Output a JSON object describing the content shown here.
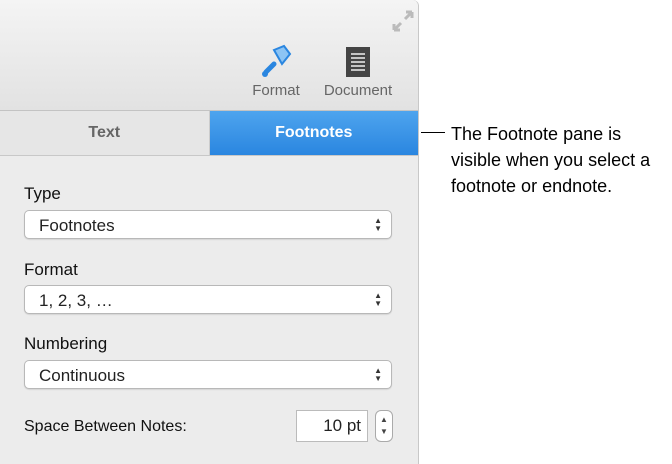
{
  "toolbar": {
    "format": "Format",
    "document": "Document"
  },
  "tabs": [
    {
      "label": "Text",
      "active": false
    },
    {
      "label": "Footnotes",
      "active": true
    }
  ],
  "type": {
    "label": "Type",
    "value": "Footnotes"
  },
  "format": {
    "label": "Format",
    "value": "1, 2, 3, …"
  },
  "numbering": {
    "label": "Numbering",
    "value": "Continuous"
  },
  "space": {
    "label": "Space Between Notes:",
    "value": "10 pt"
  },
  "callout": "The Footnote pane is visible when you select a footnote or endnote.",
  "colors": {
    "accent": "#2a86e0"
  }
}
